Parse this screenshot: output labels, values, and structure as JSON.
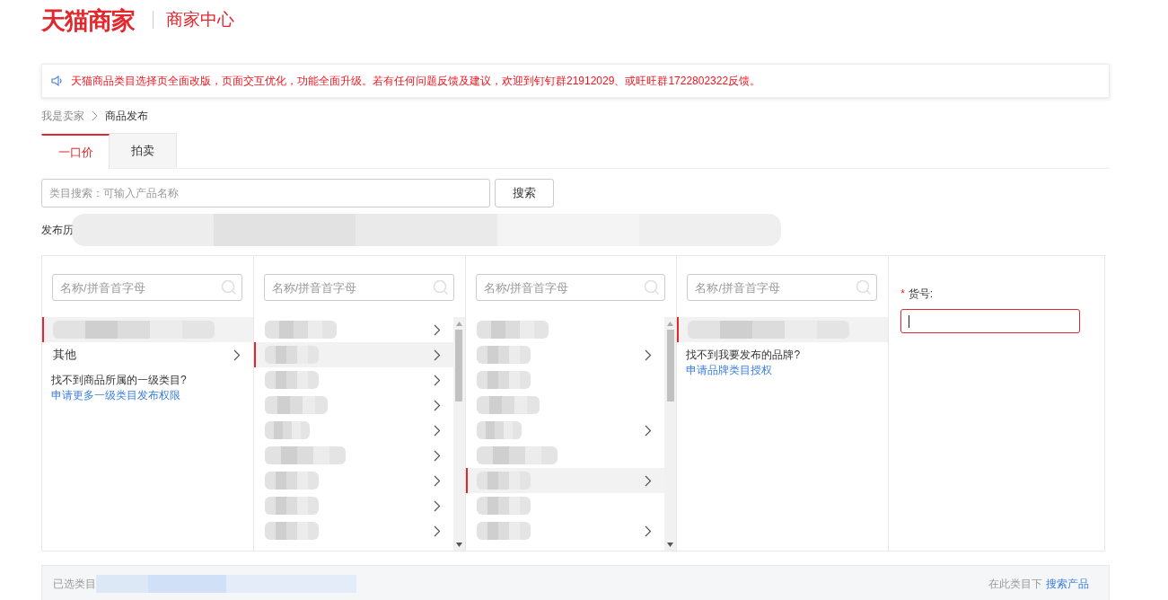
{
  "header": {
    "logo": "天猫商家",
    "subtitle": "商家中心"
  },
  "notice": {
    "text": "天猫商品类目选择页全面改版，页面交互优化，功能全面升级。若有任何问题反馈及建议，欢迎到钉钉群21912029、或旺旺群1722802322反馈。"
  },
  "breadcrumb": [
    {
      "label": "我是卖家",
      "current": false
    },
    {
      "label": "商品发布",
      "current": true
    }
  ],
  "tabs": [
    {
      "label": "一口价",
      "selected": true
    },
    {
      "label": "拍卖",
      "selected": false
    }
  ],
  "search": {
    "placeholder": "类目搜索：可输入产品名称",
    "button": "搜索"
  },
  "history": {
    "label": "发布历"
  },
  "columns": [
    {
      "placeholder": "名称/拼音首字母",
      "items": [
        {
          "kind": "redacted",
          "selected": true,
          "has_children": false
        },
        {
          "kind": "text",
          "label": "其他",
          "selected": false,
          "has_children": true
        }
      ],
      "help": "找不到商品所属的一级类目? ",
      "help_link": "申请更多一级类目发布权限"
    },
    {
      "placeholder": "名称/拼音首字母",
      "items": [
        {
          "kind": "redacted",
          "selected": false,
          "has_children": true
        },
        {
          "kind": "redacted",
          "selected": true,
          "has_children": true
        },
        {
          "kind": "redacted",
          "selected": false,
          "has_children": true
        },
        {
          "kind": "redacted",
          "selected": false,
          "has_children": true
        },
        {
          "kind": "redacted",
          "selected": false,
          "has_children": true
        },
        {
          "kind": "redacted",
          "selected": false,
          "has_children": true
        },
        {
          "kind": "redacted",
          "selected": false,
          "has_children": true
        },
        {
          "kind": "redacted",
          "selected": false,
          "has_children": true
        },
        {
          "kind": "redacted",
          "selected": false,
          "has_children": true
        }
      ]
    },
    {
      "placeholder": "名称/拼音首字母",
      "items": [
        {
          "kind": "redacted",
          "selected": false,
          "has_children": false
        },
        {
          "kind": "redacted",
          "selected": false,
          "has_children": true
        },
        {
          "kind": "redacted",
          "selected": false,
          "has_children": false
        },
        {
          "kind": "redacted",
          "selected": false,
          "has_children": false
        },
        {
          "kind": "redacted",
          "selected": false,
          "has_children": true
        },
        {
          "kind": "redacted",
          "selected": false,
          "has_children": false
        },
        {
          "kind": "redacted",
          "selected": true,
          "has_children": true
        },
        {
          "kind": "redacted",
          "selected": false,
          "has_children": false
        },
        {
          "kind": "redacted",
          "selected": false,
          "has_children": true
        }
      ]
    },
    {
      "placeholder": "名称/拼音首字母",
      "items": [
        {
          "kind": "redacted",
          "selected": true,
          "has_children": false
        }
      ],
      "help": "找不到我要发布的品牌? ",
      "help_link": "申请品牌类目授权"
    }
  ],
  "form": {
    "required_mark": "*",
    "label": "货号:",
    "focused": true
  },
  "footer": {
    "label": "已选类目",
    "action_prefix": "在此类目下",
    "action_link": "搜索产品"
  }
}
